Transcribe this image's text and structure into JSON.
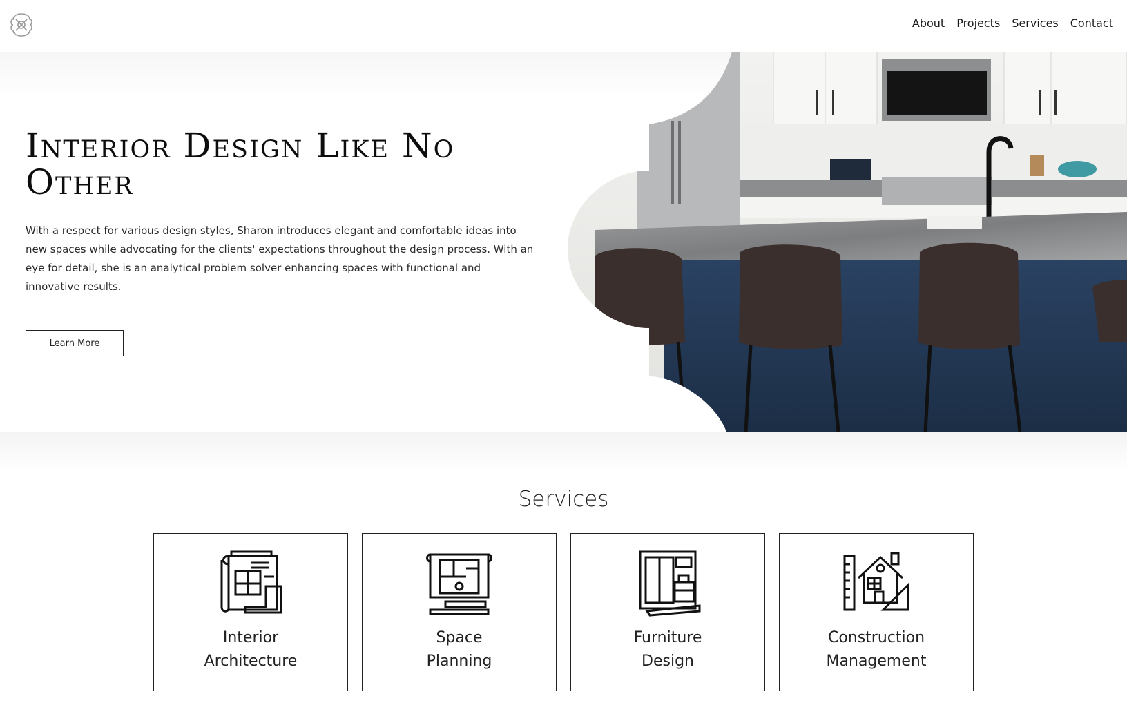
{
  "nav": {
    "logo_icon": "logo-icon",
    "items": [
      {
        "label": "About"
      },
      {
        "label": "Projects"
      },
      {
        "label": "Services"
      },
      {
        "label": "Contact"
      }
    ]
  },
  "hero": {
    "title": "Interior Design Like No Other",
    "text": "With a respect for various design styles, Sharon introduces elegant and comfortable ideas into new spaces while advocating for the clients' expectations throughout the design process. With an eye for detail, she is an analytical problem solver enhancing spaces with functional and innovative results.",
    "button_label": "Learn More",
    "image_icon": "kitchen-photo",
    "colors": {
      "island": "#243a57",
      "counter": "#8e8f90",
      "stool": "#3a2f2c"
    }
  },
  "services": {
    "title": "Services",
    "cards": [
      {
        "line1": "Interior",
        "line2": "Architecture",
        "icon": "blueprint-icon"
      },
      {
        "line1": "Space",
        "line2": "Planning",
        "icon": "floor-plan-icon"
      },
      {
        "line1": "Furniture",
        "line2": "Design",
        "icon": "furniture-icon"
      },
      {
        "line1": "Construction",
        "line2": "Management",
        "icon": "house-construction-icon"
      }
    ]
  }
}
